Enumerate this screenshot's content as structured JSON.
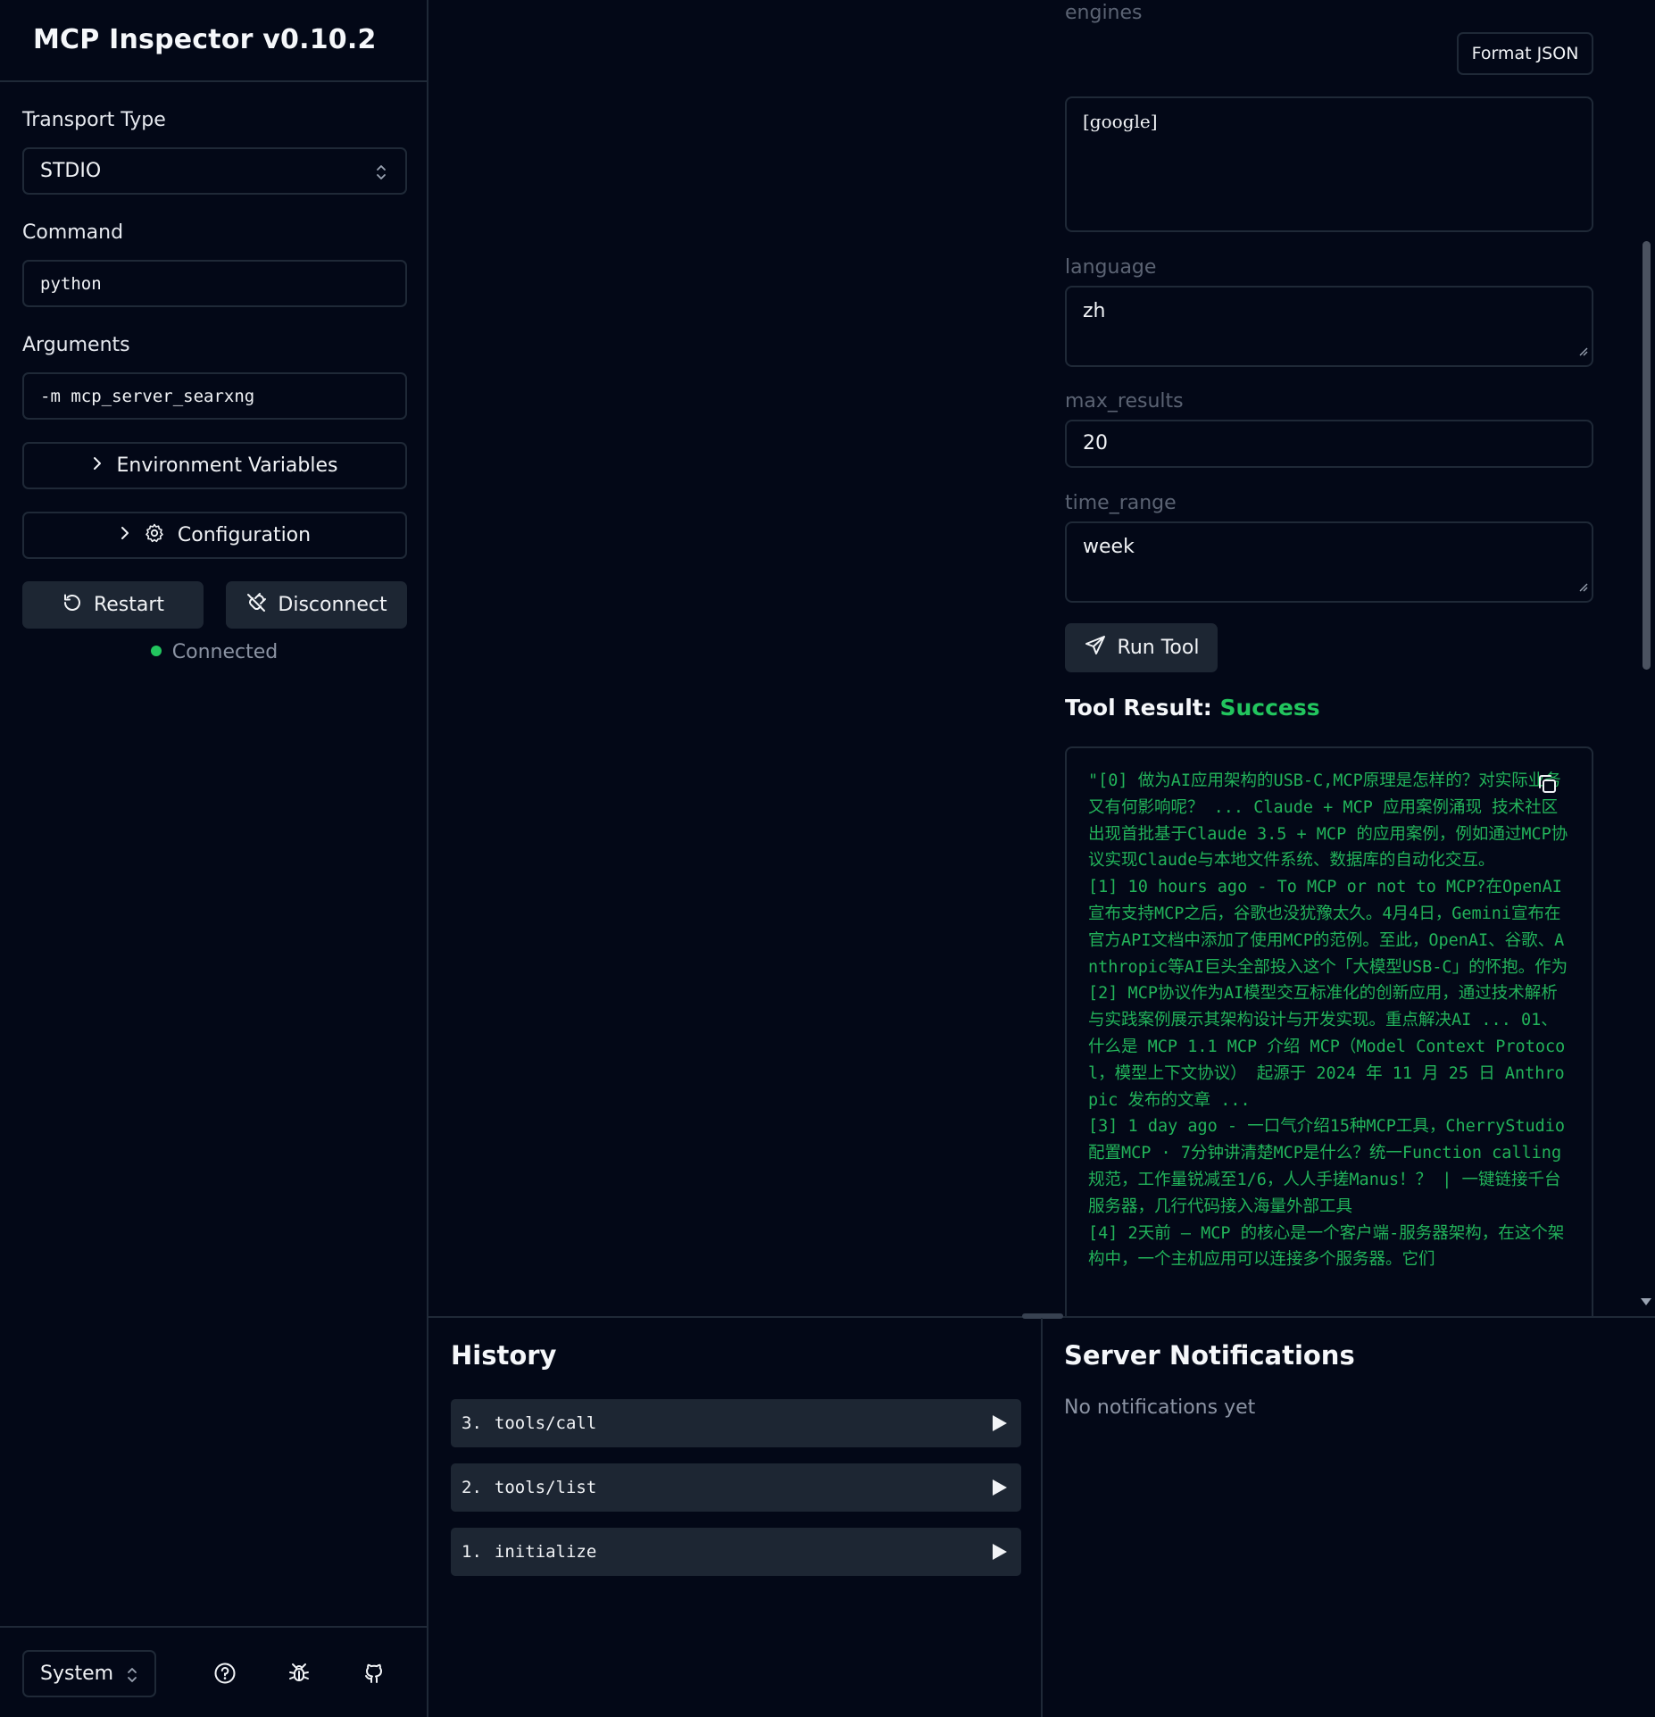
{
  "app": {
    "title": "MCP Inspector v0.10.2"
  },
  "sidebar": {
    "transport_label": "Transport Type",
    "transport_value": "STDIO",
    "command_label": "Command",
    "command_value": "python",
    "arguments_label": "Arguments",
    "arguments_value": "-m mcp_server_searxng",
    "env_label": "Environment Variables",
    "config_label": "Configuration",
    "restart_label": "Restart",
    "disconnect_label": "Disconnect",
    "status_text": "Connected",
    "status_color": "#22c55e",
    "theme_value": "System"
  },
  "tool": {
    "engines_label": "engines",
    "format_json_label": "Format JSON",
    "engines_value": "[google]",
    "language_label": "language",
    "language_value": "zh",
    "max_results_label": "max_results",
    "max_results_value": "20",
    "time_range_label": "time_range",
    "time_range_value": "week",
    "run_label": "Run Tool",
    "result_heading": "Tool Result:",
    "result_status": "Success",
    "result_lines": [
      "\"[0] 做为AI应用架构的USB-C,MCP原理是怎样的？对实际业务又有何影响呢？ ... Claude + MCP 应用案例涌现 技术社区出现首批基于Claude 3.5 + MCP 的应用案例，例如通过MCP协议实现Claude与本地文件系统、数据库的自动化交互。",
      "[1] 10 hours ago - To MCP or not to MCP?在OpenAI宣布支持MCP之后，谷歌也没犹豫太久。4月4日，Gemini宣布在官方API文档中添加了使用MCP的范例。至此，OpenAI、谷歌、Anthropic等AI巨头全部投入这个「大模型USB-C」的怀抱。作为",
      "[2] MCP协议作为AI模型交互标准化的创新应用，通过技术解析与实践案例展示其架构设计与开发实现。重点解决AI ... 01、什么是 MCP 1.1 MCP 介绍 MCP（Model Context Protocol，模型上下文协议） 起源于 2024 年 11 月 25 日 Anthropic 发布的文章 ...",
      "[3] 1 day ago - 一口气介绍15种MCP工具，CherryStudio配置MCP · 7分钟讲清楚MCP是什么？统一Function calling规范，工作量锐减至1/6，人人手搓Manus！？ | 一键链接千台服务器，几行代码接入海量外部工具",
      "[4] 2天前 — MCP 的核心是一个客户端-服务器架构，在这个架构中，一个主机应用可以连接多个服务器。它们"
    ],
    "accent_color": "#22c55e"
  },
  "history": {
    "title": "History",
    "items": [
      {
        "num": "3.",
        "method": "tools/call"
      },
      {
        "num": "2.",
        "method": "tools/list"
      },
      {
        "num": "1.",
        "method": "initialize"
      }
    ]
  },
  "notifications": {
    "title": "Server Notifications",
    "empty_text": "No notifications yet"
  },
  "icons": {
    "select": "chevron-up-down-icon",
    "expand": "chevron-right-icon",
    "settings": "gear-icon",
    "restart": "rotate-ccw-icon",
    "disconnect": "unplug-icon",
    "run": "send-icon",
    "copy": "copy-icon",
    "play": "play-icon",
    "help": "help-circle-icon",
    "bug": "bug-icon",
    "github": "github-icon"
  }
}
